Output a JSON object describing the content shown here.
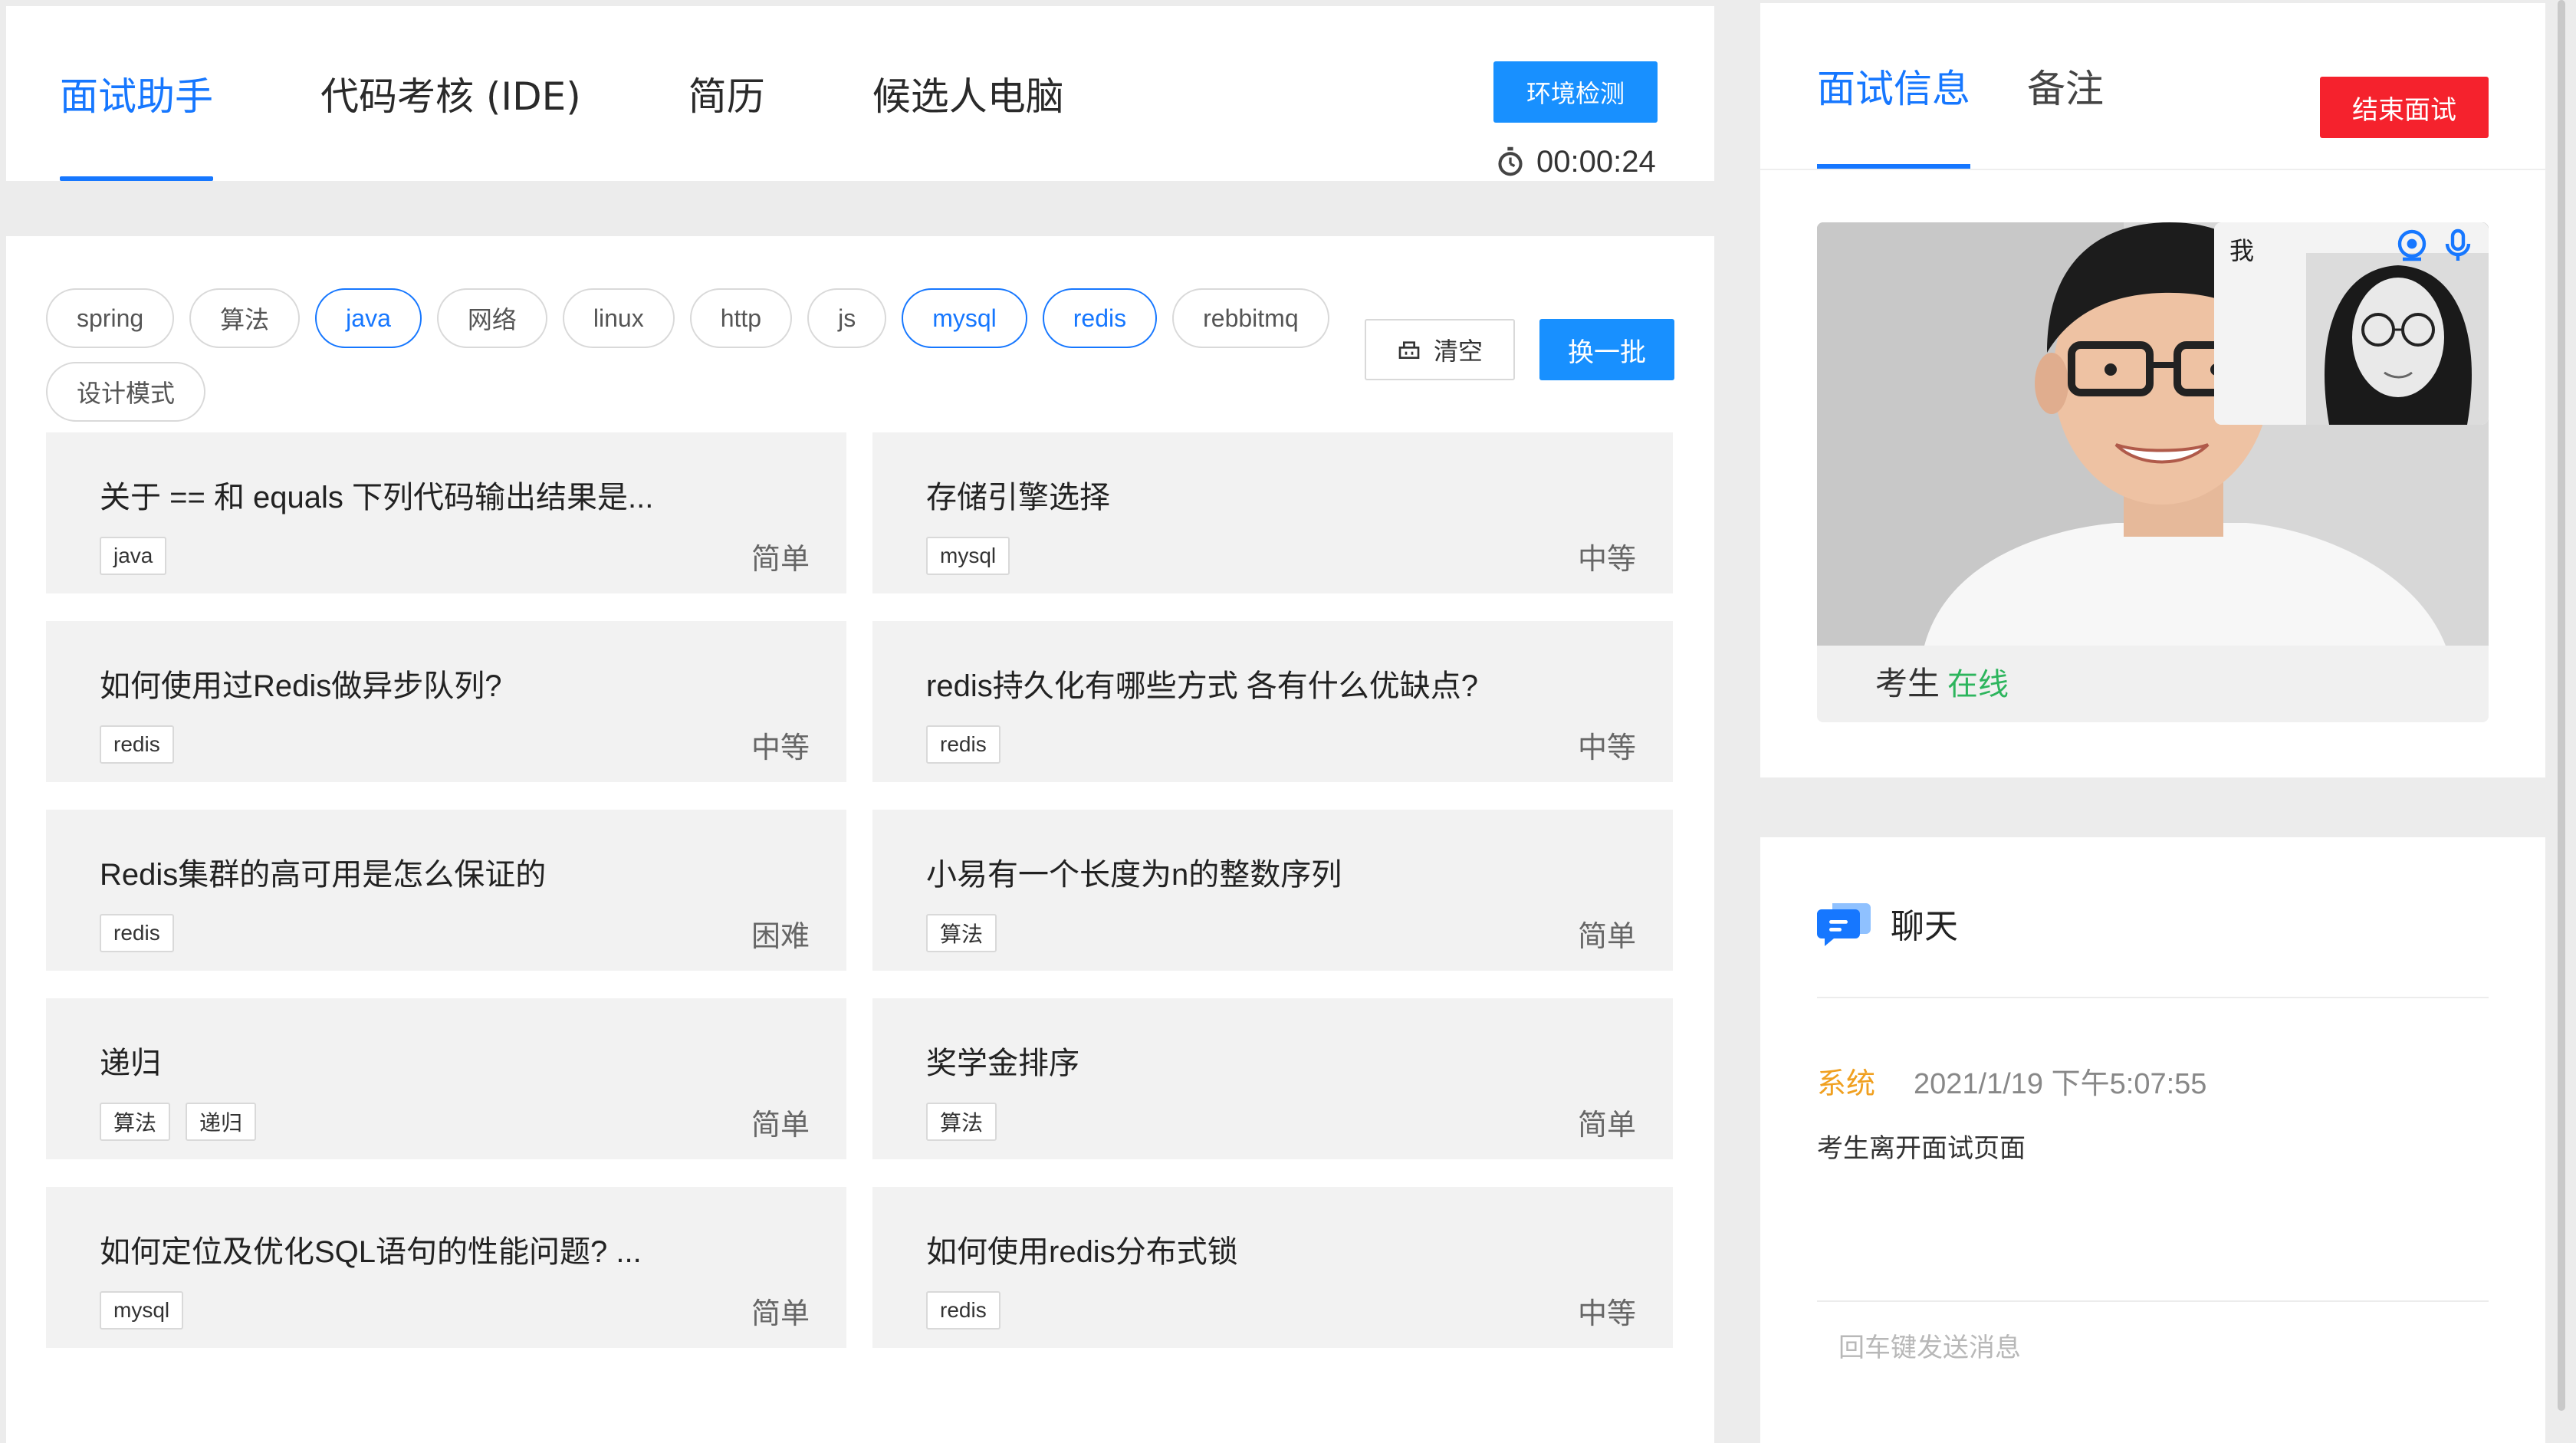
{
  "header": {
    "tabs": [
      {
        "label": "面试助手",
        "active": true
      },
      {
        "label": "代码考核 (IDE)",
        "active": false
      },
      {
        "label": "简历",
        "active": false
      },
      {
        "label": "候选人电脑",
        "active": false
      }
    ],
    "env_check_label": "环境检测",
    "timer": "00:00:24"
  },
  "filters": {
    "tags": [
      {
        "label": "spring",
        "selected": false
      },
      {
        "label": "算法",
        "selected": false
      },
      {
        "label": "java",
        "selected": true
      },
      {
        "label": "网络",
        "selected": false
      },
      {
        "label": "linux",
        "selected": false
      },
      {
        "label": "http",
        "selected": false
      },
      {
        "label": "js",
        "selected": false
      },
      {
        "label": "mysql",
        "selected": true
      },
      {
        "label": "redis",
        "selected": true
      },
      {
        "label": "rebbitmq",
        "selected": false
      },
      {
        "label": "设计模式",
        "selected": false
      }
    ],
    "clear_label": "清空",
    "next_batch_label": "换一批"
  },
  "questions": [
    {
      "title": "关于 == 和 equals 下列代码输出结果是...",
      "tags": [
        "java"
      ],
      "difficulty": "简单"
    },
    {
      "title": "存储引擎选择",
      "tags": [
        "mysql"
      ],
      "difficulty": "中等"
    },
    {
      "title": "如何使用过Redis做异步队列?",
      "tags": [
        "redis"
      ],
      "difficulty": "中等"
    },
    {
      "title": "redis持久化有哪些方式 各有什么优缺点?",
      "tags": [
        "redis"
      ],
      "difficulty": "中等"
    },
    {
      "title": "Redis集群的高可用是怎么保证的",
      "tags": [
        "redis"
      ],
      "difficulty": "困难"
    },
    {
      "title": "小易有一个长度为n的整数序列",
      "tags": [
        "算法"
      ],
      "difficulty": "简单"
    },
    {
      "title": "递归",
      "tags": [
        "算法",
        "递归"
      ],
      "difficulty": "简单"
    },
    {
      "title": "奖学金排序",
      "tags": [
        "算法"
      ],
      "difficulty": "简单"
    },
    {
      "title": "如何定位及优化SQL语句的性能问题? ...",
      "tags": [
        "mysql"
      ],
      "difficulty": "简单"
    },
    {
      "title": "如何使用redis分布式锁",
      "tags": [
        "redis"
      ],
      "difficulty": "中等"
    }
  ],
  "info_panel": {
    "tabs": [
      {
        "label": "面试信息",
        "active": true
      },
      {
        "label": "备注",
        "active": false
      }
    ],
    "end_label": "结束面试",
    "self_label": "我",
    "candidate_label": "考生",
    "candidate_status": "在线"
  },
  "chat": {
    "title": "聊天",
    "messages": [
      {
        "sender": "系统",
        "time": "2021/1/19 下午5:07:55",
        "text": "考生离开面试页面"
      }
    ],
    "input_placeholder": "回车键发送消息"
  },
  "colors": {
    "primary": "#1677ff",
    "danger": "#f5222d",
    "online": "#2db55d",
    "system": "#f0a020"
  }
}
